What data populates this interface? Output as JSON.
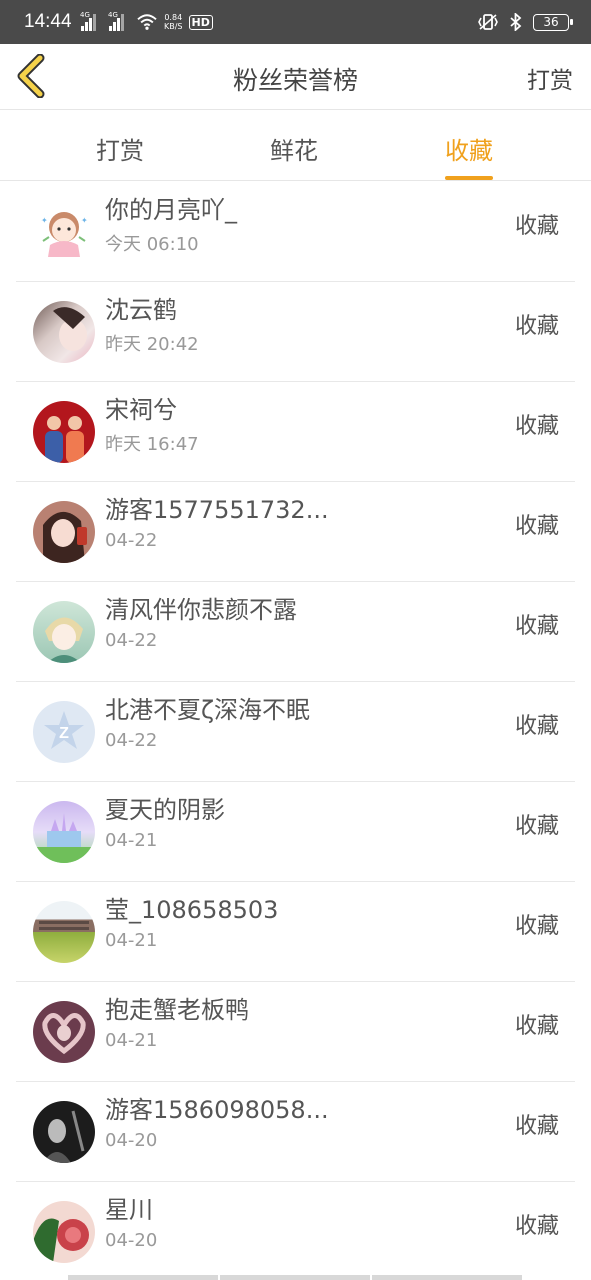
{
  "status_bar": {
    "time": "14:44",
    "network_1": "4G",
    "network_2": "4G",
    "speed_value": "0.84",
    "speed_unit": "KB/S",
    "hd": "HD",
    "battery": "36"
  },
  "header": {
    "title": "粉丝荣誉榜",
    "right_action": "打赏",
    "back_icon": "chevron-left-icon",
    "accent_color": "#f0a11d"
  },
  "tabs": [
    {
      "label": "打赏",
      "active": false
    },
    {
      "label": "鲜花",
      "active": false
    },
    {
      "label": "收藏",
      "active": true
    }
  ],
  "list": [
    {
      "name": "你的月亮吖_",
      "time": "今天 06:10",
      "action": "收藏",
      "avatar": "cartoon-girl-avatar"
    },
    {
      "name": "沈云鹤",
      "time": "昨天 20:42",
      "action": "收藏",
      "avatar": "photo-avatar"
    },
    {
      "name": "宋祠兮",
      "time": "昨天 16:47",
      "action": "收藏",
      "avatar": "couple-photo-avatar"
    },
    {
      "name": "游客1577551732...",
      "time": "04-22",
      "action": "收藏",
      "avatar": "girl-photo-avatar"
    },
    {
      "name": "清风伴你悲颜不露",
      "time": "04-22",
      "action": "收藏",
      "avatar": "anime-avatar"
    },
    {
      "name": "北港不夏ζ深海不眠",
      "time": "04-22",
      "action": "收藏",
      "avatar": "default-avatar"
    },
    {
      "name": "夏天的阴影",
      "time": "04-21",
      "action": "收藏",
      "avatar": "castle-avatar"
    },
    {
      "name": "莹_108658503",
      "time": "04-21",
      "action": "收藏",
      "avatar": "landscape-avatar"
    },
    {
      "name": "抱走蟹老板鸭",
      "time": "04-21",
      "action": "收藏",
      "avatar": "heart-hands-avatar"
    },
    {
      "name": "游客1586098058...",
      "time": "04-20",
      "action": "收藏",
      "avatar": "dark-photo-avatar"
    },
    {
      "name": "星川",
      "time": "04-20",
      "action": "收藏",
      "avatar": "flower-avatar"
    }
  ]
}
